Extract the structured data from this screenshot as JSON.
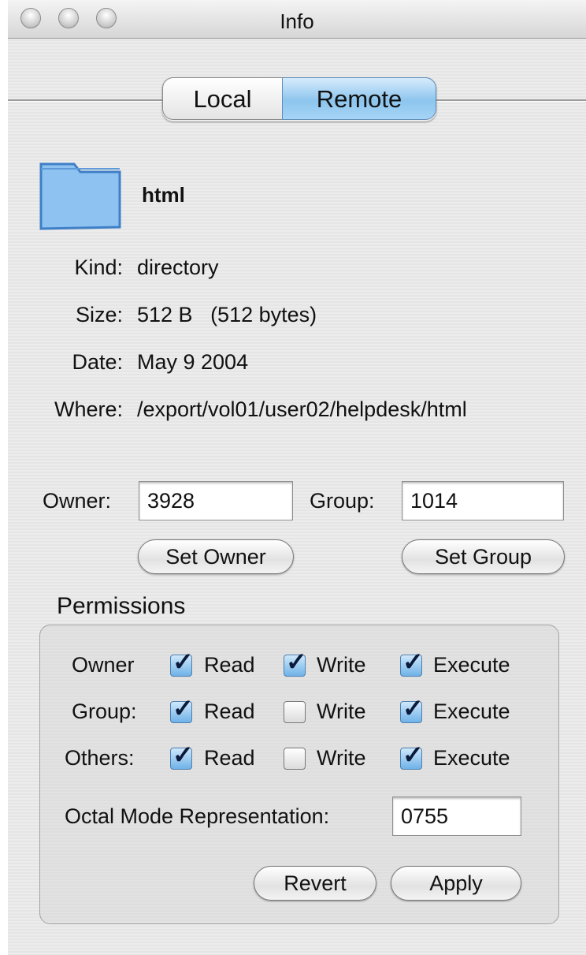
{
  "window": {
    "title": "Info"
  },
  "tabs": {
    "local": "Local",
    "remote": "Remote",
    "selected": "Remote"
  },
  "file": {
    "icon": "folder-icon",
    "name": "html"
  },
  "info": [
    {
      "label": "Kind:",
      "value": "directory"
    },
    {
      "label": "Size:",
      "value": "512 B   (512 bytes)"
    },
    {
      "label": "Date:",
      "value": "May 9 2004"
    },
    {
      "label": "Where:",
      "value": "/export/vol01/user02/helpdesk/html"
    }
  ],
  "ownership": {
    "owner_label": "Owner:",
    "owner_value": "3928",
    "group_label": "Group:",
    "group_value": "1014",
    "set_owner": "Set Owner",
    "set_group": "Set Group"
  },
  "permissions": {
    "title": "Permissions",
    "rows": [
      {
        "label": "Owner",
        "read": true,
        "write": true,
        "execute": true
      },
      {
        "label": "Group:",
        "read": true,
        "write": false,
        "execute": true
      },
      {
        "label": "Others:",
        "read": true,
        "write": false,
        "execute": true
      }
    ],
    "read_label": "Read",
    "write_label": "Write",
    "execute_label": "Execute",
    "octal_label": "Octal Mode Representation:",
    "octal_value": "0755",
    "revert": "Revert",
    "apply": "Apply"
  }
}
